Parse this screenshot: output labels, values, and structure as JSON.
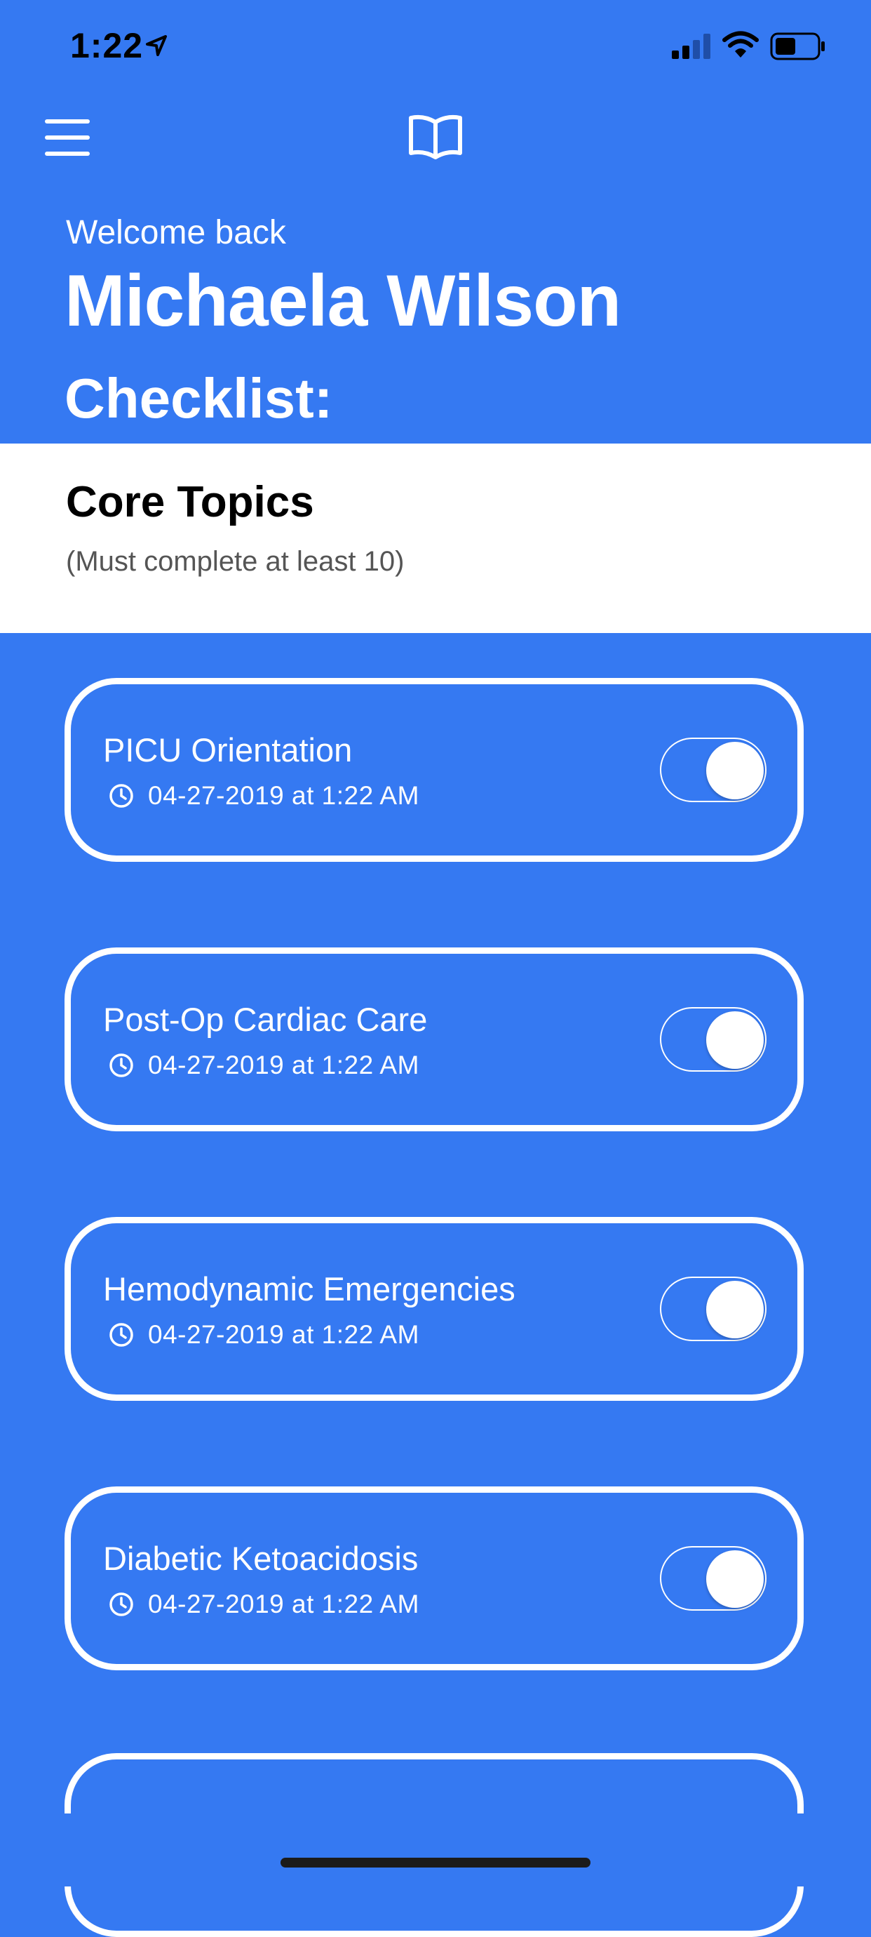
{
  "status_bar": {
    "time": "1:22",
    "icons": [
      "location-arrow-icon",
      "cellular-signal-icon",
      "wifi-icon",
      "battery-icon"
    ]
  },
  "nav": {
    "menu_icon": "hamburger-menu-icon",
    "logo_icon": "open-book-icon"
  },
  "header": {
    "welcome": "Welcome back",
    "user_name": "Michaela Wilson",
    "checklist_title": "Checklist:"
  },
  "section": {
    "title": "Core Topics",
    "subtitle": "(Must complete at least 10)"
  },
  "items": [
    {
      "title": "PICU Orientation",
      "timestamp": "04-27-2019 at 1:22 AM",
      "completed": true
    },
    {
      "title": "Post-Op Cardiac Care",
      "timestamp": "04-27-2019 at 1:22 AM",
      "completed": true
    },
    {
      "title": "Hemodynamic Emergencies",
      "timestamp": "04-27-2019 at 1:22 AM",
      "completed": true
    },
    {
      "title": "Diabetic Ketoacidosis",
      "timestamp": "04-27-2019 at 1:22 AM",
      "completed": true
    }
  ],
  "colors": {
    "background": "#3579f2",
    "card_border": "#ffffff",
    "section_band": "#ffffff"
  }
}
